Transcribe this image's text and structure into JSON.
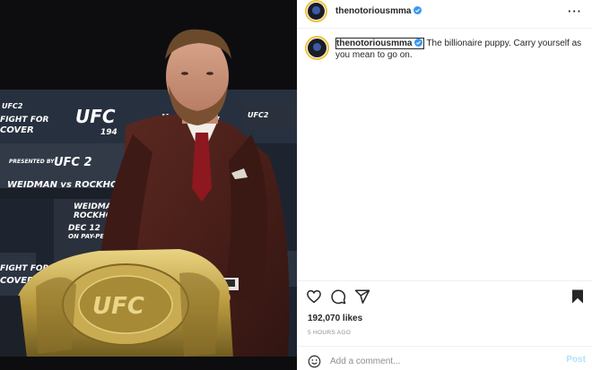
{
  "post": {
    "username": "thenotoriousmma",
    "caption_text": "The billionaire puppy. Carry yourself as you mean to go on.",
    "likes": "192,070 likes",
    "time": "5 HOURS AGO"
  },
  "comment": {
    "placeholder": "Add a comment...",
    "post_label": "Post"
  },
  "header": {
    "more_label": "···"
  },
  "photo": {
    "backdrop_text": {
      "ufc_logo": "UFC",
      "event_number": "194",
      "ufc_left": "UFC2",
      "fight_for": "FIGHT FOR",
      "cover": "COVER",
      "presented_by": "PRESENTED BY",
      "ea_ufc2": "UFC 2",
      "weidman_rockhold": "WEIDMAN vs ROCKHOLD",
      "weidman": "WEIDMAN",
      "rockhold": "ROCKHOLD",
      "date": "DEC 12",
      "on_ppv": "ON PAY-PER",
      "mc": "Mc",
      "ufc_right": "UFC2",
      "er": "ER"
    }
  },
  "icons": {
    "verified": "verified-badge-icon",
    "heart": "heart-icon",
    "comment": "comment-icon",
    "share": "share-icon",
    "save": "bookmark-icon",
    "emoji": "emoji-icon",
    "more": "more-icon"
  },
  "colors": {
    "verified_blue": "#3897f0",
    "text": "#262626",
    "muted": "#8e8e8e",
    "post_disabled": "#b2dffc"
  }
}
